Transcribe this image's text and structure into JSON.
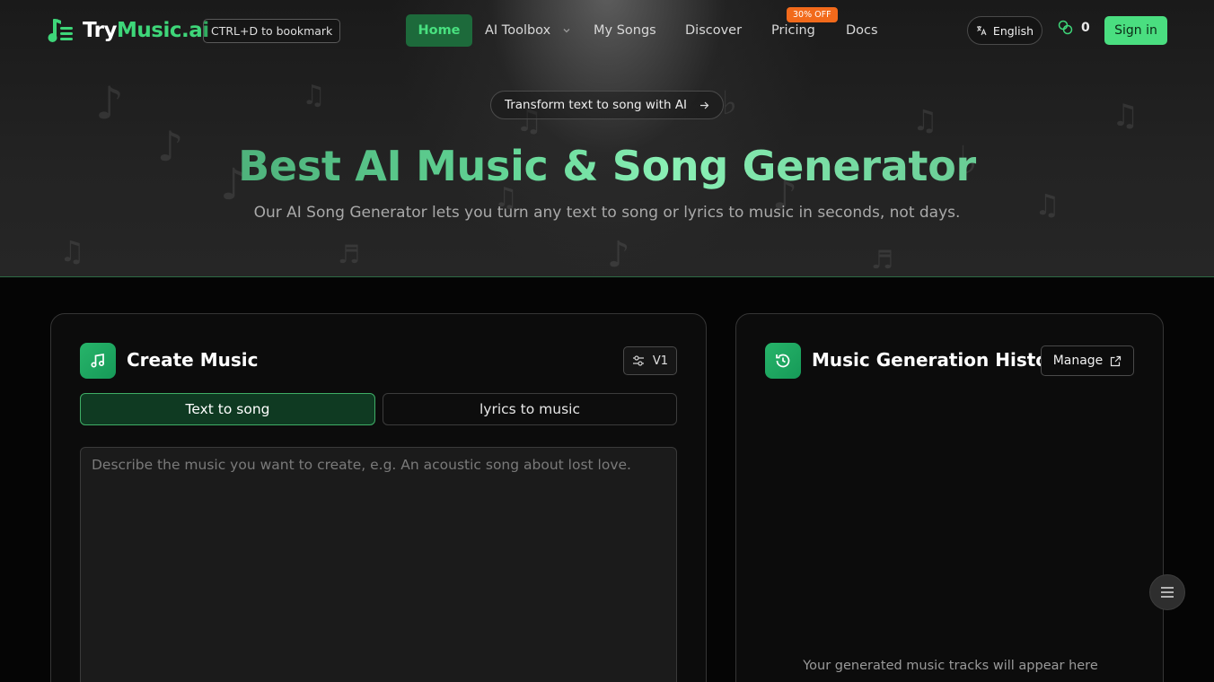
{
  "brand": {
    "name_part1": "Try",
    "name_part2": "Music.ai",
    "bookmark_hint": "CTRL+D to bookmark",
    "accent": "#3ed679"
  },
  "nav": {
    "items": [
      {
        "label": "Home",
        "active": true
      },
      {
        "label": "AI Toolbox",
        "has_dropdown": true
      },
      {
        "label": "My Songs"
      },
      {
        "label": "Discover"
      },
      {
        "label": "Pricing",
        "badge": "30% OFF"
      },
      {
        "label": "Docs"
      }
    ],
    "language": "English",
    "credits": "0",
    "signin_label": "Sign in"
  },
  "hero": {
    "pill_text": "Transform text to song with AI",
    "title": "Best AI Music & Song Generator",
    "subtitle": "Our AI Song Generator lets you turn any text to song or lyrics to music in seconds, not days."
  },
  "create": {
    "title": "Create Music",
    "version_label": "V1",
    "tabs": [
      {
        "label": "Text to song",
        "active": true
      },
      {
        "label": "lyrics to music",
        "active": false
      }
    ],
    "prompt_placeholder": "Describe the music you want to create, e.g. An acoustic song about lost love.",
    "prompt_value": ""
  },
  "history": {
    "title": "Music Generation History",
    "manage_label": "Manage",
    "empty_text": "Your generated music tracks will appear here"
  },
  "icons": {
    "logo": "music-list-icon",
    "language": "translate-icon",
    "credits": "coins-icon",
    "version": "sliders-icon",
    "create": "music-note-icon",
    "history": "history-icon",
    "manage": "external-link-icon",
    "fab": "menu-icon"
  }
}
